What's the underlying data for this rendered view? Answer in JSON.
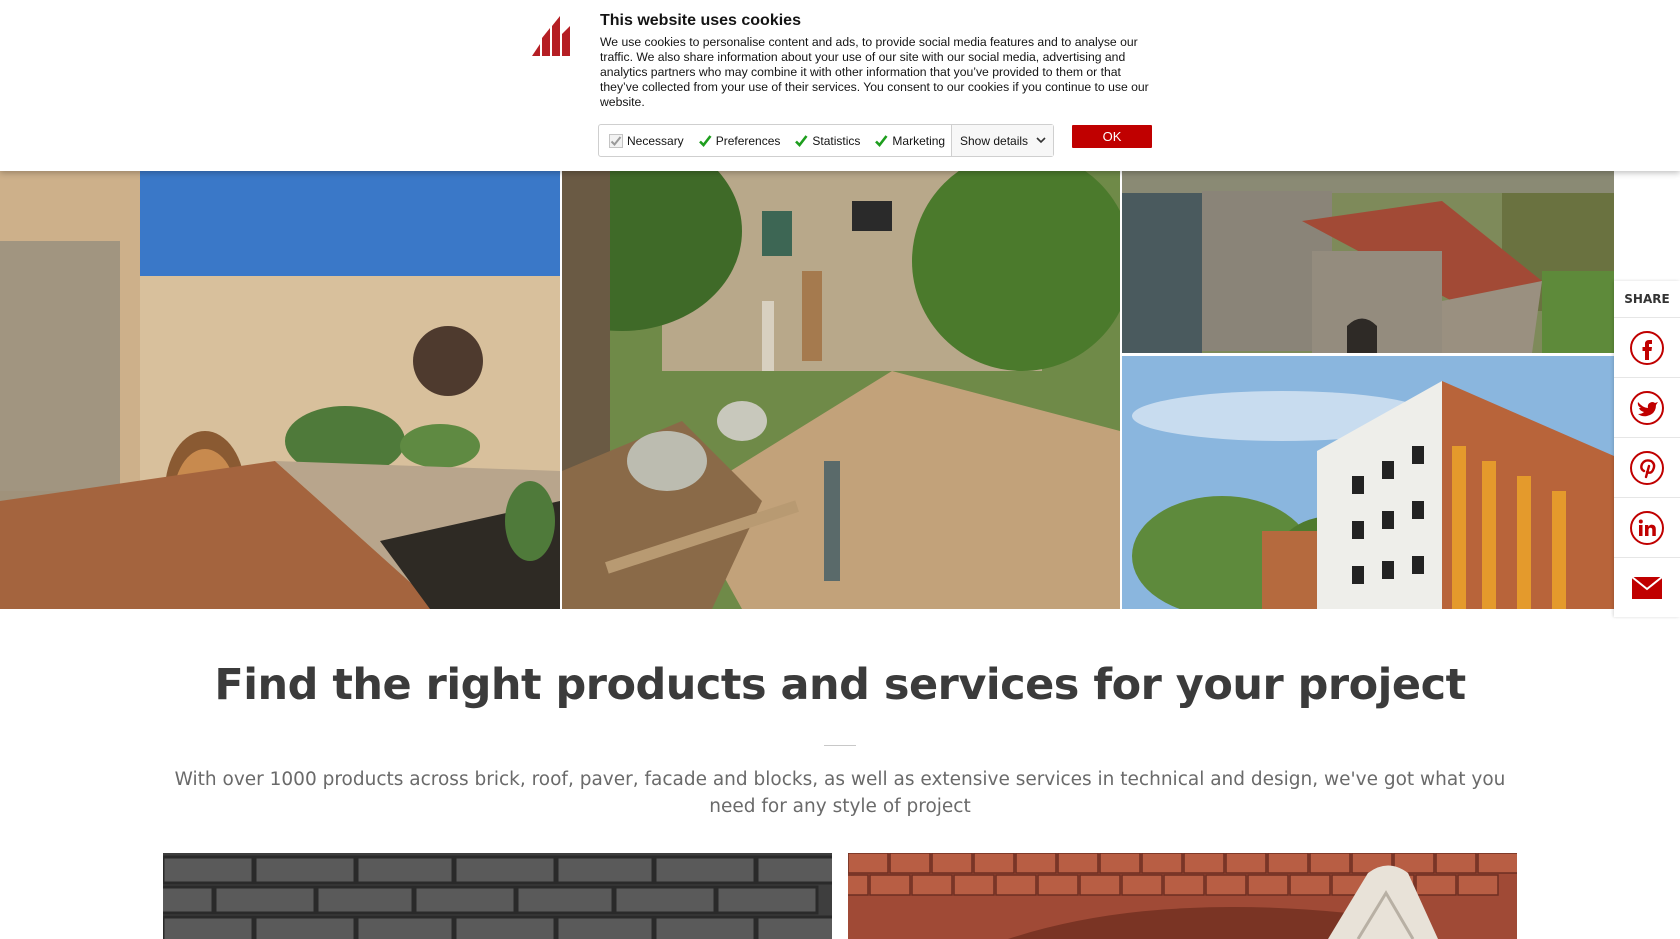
{
  "cookie_banner": {
    "title": "This website uses cookies",
    "text": "We use cookies to personalise content and ads, to provide social media features and to analyse our traffic. We also share information about your use of our site with our social media, advertising and analytics partners who may combine it with other information that you’ve provided to them or that they’ve collected from your use of their services. You consent to our cookies if you continue to use our website.",
    "checkboxes": [
      {
        "label": "Necessary",
        "checked": true,
        "disabled": true
      },
      {
        "label": "Preferences",
        "checked": true
      },
      {
        "label": "Statistics",
        "checked": true
      },
      {
        "label": "Marketing",
        "checked": true
      }
    ],
    "show_details_label": "Show details",
    "ok_label": "OK",
    "accent_color": "#c00000",
    "check_color": "#1e9e1e"
  },
  "share": {
    "label": "SHARE",
    "items": [
      "facebook-icon",
      "twitter-icon",
      "pinterest-icon",
      "linkedin-icon",
      "email-icon"
    ],
    "icon_color": "#c00000"
  },
  "main": {
    "headline": "Find the right products and services for your project",
    "subtext": "With over 1000 products across brick, roof, paver, facade and blocks, as well as extensive services in technical and design, we've got what you need for any style of project"
  },
  "hero_images": [
    "courtyard-photo",
    "garden-photo",
    "castle-photo",
    "apartment-building-photo"
  ],
  "cards": [
    "brick-card",
    "roof-tile-card"
  ]
}
